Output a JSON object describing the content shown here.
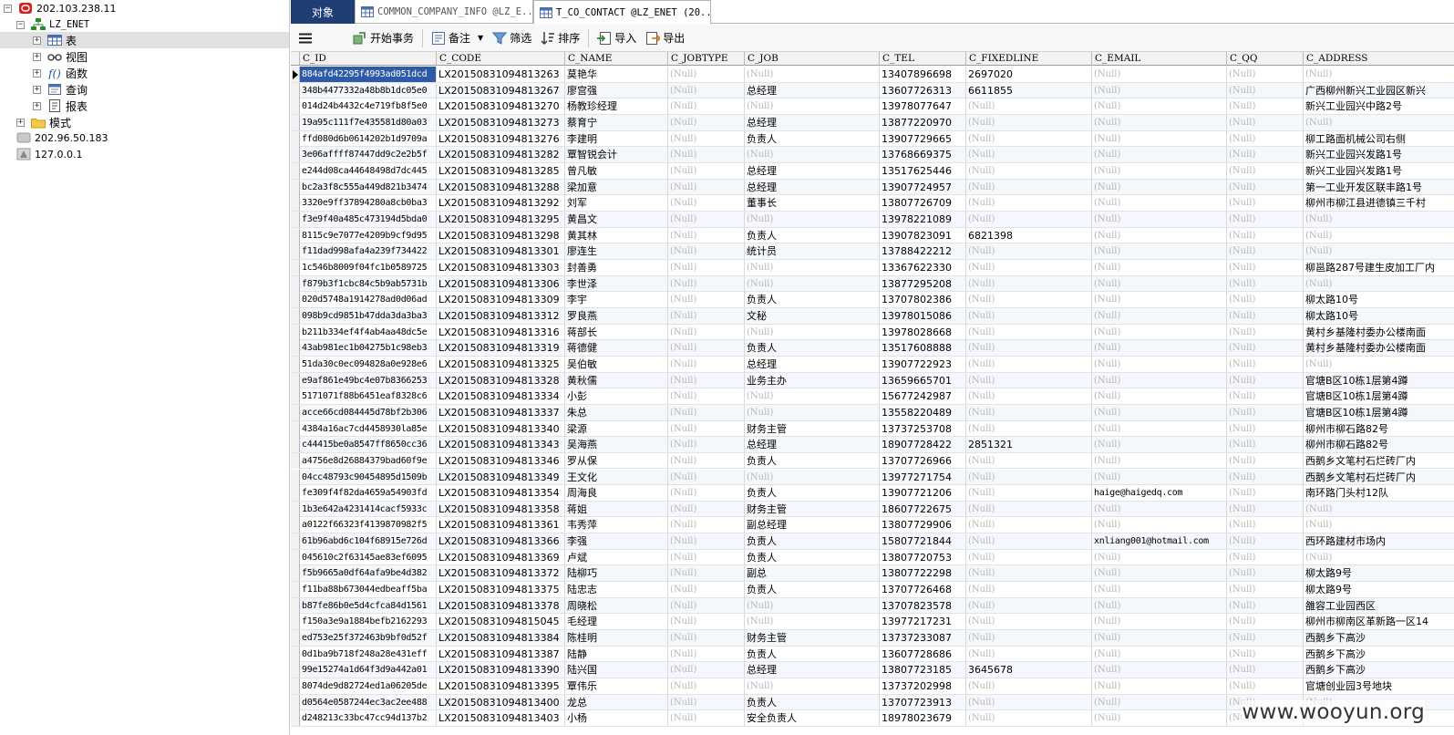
{
  "tree": {
    "nodes": [
      {
        "label": "202.103.238.11",
        "icon": "oracle-connection-icon",
        "toggle": "−",
        "level": 0
      },
      {
        "label": "LZ_ENET",
        "icon": "schema-icon",
        "toggle": "−",
        "level": 1
      },
      {
        "label": "表",
        "icon": "table-icon",
        "toggle": "+",
        "level": 2,
        "selected": true
      },
      {
        "label": "视图",
        "icon": "view-icon",
        "toggle": "+",
        "level": 2
      },
      {
        "label": "函数",
        "icon": "function-icon",
        "toggle": "+",
        "level": 2
      },
      {
        "label": "查询",
        "icon": "query-icon",
        "toggle": "+",
        "level": 2
      },
      {
        "label": "报表",
        "icon": "report-icon",
        "toggle": "+",
        "level": 2
      },
      {
        "label": "模式",
        "icon": "folder-icon",
        "toggle": "+",
        "level": 1
      },
      {
        "label": "202.96.50.183",
        "icon": "connection-icon",
        "toggle": "",
        "level": 0
      },
      {
        "label": "127.0.0.1",
        "icon": "connection-icon",
        "toggle": "",
        "level": 0
      }
    ]
  },
  "tabs": [
    {
      "label": "对象",
      "type": "object"
    },
    {
      "label": "COMMON_COMPANY_INFO @LZ_E...",
      "type": "table"
    },
    {
      "label": "T_CO_CONTACT @LZ_ENET (20...",
      "type": "table",
      "active": true
    }
  ],
  "toolbar": {
    "begin_tx": "开始事务",
    "memo": "备注",
    "filter": "筛选",
    "sort": "排序",
    "import": "导入",
    "export": "导出"
  },
  "grid": {
    "columns": [
      "C_ID",
      "C_CODE",
      "C_NAME",
      "C_JOBTYPE",
      "C_JOB",
      "C_TEL",
      "C_FIXEDLINE",
      "C_EMAIL",
      "C_QQ",
      "C_ADDRESS"
    ],
    "null_text": "(Null)",
    "rows": [
      [
        "884afd42295f4993ad051dcd",
        "LX20150831094813263",
        "莫艳华",
        "(Null)",
        "(Null)",
        "13407896698",
        "2697020",
        "(Null)",
        "(Null)",
        "(Null)"
      ],
      [
        "348b4477332a48b8b1dc05e0",
        "LX20150831094813267",
        "廖宫强",
        "(Null)",
        "总经理",
        "13607726313",
        "6611855",
        "(Null)",
        "(Null)",
        "广西柳州新兴工业园区新兴"
      ],
      [
        "014d24b4432c4e719fb8f5e0",
        "LX20150831094813270",
        "杨教珍经理",
        "(Null)",
        "(Null)",
        "13978077647",
        "(Null)",
        "(Null)",
        "(Null)",
        "新兴工业园兴中路2号"
      ],
      [
        "19a95c111f7e435581d80a03",
        "LX20150831094813273",
        "蔡育宁",
        "(Null)",
        "总经理",
        "13877220970",
        "(Null)",
        "(Null)",
        "(Null)",
        "(Null)"
      ],
      [
        "ffd080d6b0614202b1d9709a",
        "LX20150831094813276",
        "李建明",
        "(Null)",
        "负责人",
        "13907729665",
        "(Null)",
        "(Null)",
        "(Null)",
        "柳工路面机械公司右侧"
      ],
      [
        "3e06affff87447dd9c2e2b5f",
        "LX20150831094813282",
        "覃智锐会计",
        "(Null)",
        "(Null)",
        "13768669375",
        "(Null)",
        "(Null)",
        "(Null)",
        "新兴工业园兴发路1号"
      ],
      [
        "e244d08ca44648498d7dc445",
        "LX20150831094813285",
        "曾凡敏",
        "(Null)",
        "总经理",
        "13517625446",
        "(Null)",
        "(Null)",
        "(Null)",
        "新兴工业园兴发路1号"
      ],
      [
        "bc2a3f8c555a449d821b3474",
        "LX20150831094813288",
        "梁加意",
        "(Null)",
        "总经理",
        "13907724957",
        "(Null)",
        "(Null)",
        "(Null)",
        "第一工业开发区联丰路1号"
      ],
      [
        "3320e9ff37894280a8cb0ba3",
        "LX20150831094813292",
        "刘军",
        "(Null)",
        "董事长",
        "13807726709",
        "(Null)",
        "(Null)",
        "(Null)",
        "柳州市柳江县进德镇三千村"
      ],
      [
        "f3e9f40a485c473194d5bda0",
        "LX20150831094813295",
        "黄昌文",
        "(Null)",
        "(Null)",
        "13978221089",
        "(Null)",
        "(Null)",
        "(Null)",
        "(Null)"
      ],
      [
        "8115c9e7077e4209b9cf9d95",
        "LX20150831094813298",
        "黄其林",
        "(Null)",
        "负责人",
        "13907823091",
        "6821398",
        "(Null)",
        "(Null)",
        "(Null)"
      ],
      [
        "f11dad998afa4a239f734422",
        "LX20150831094813301",
        "廖连生",
        "(Null)",
        "统计员",
        "13788422212",
        "(Null)",
        "(Null)",
        "(Null)",
        "(Null)"
      ],
      [
        "1c546b8009f04fc1b0589725",
        "LX20150831094813303",
        "封善勇",
        "(Null)",
        "(Null)",
        "13367622330",
        "(Null)",
        "(Null)",
        "(Null)",
        "柳邕路287号建生皮加工厂内"
      ],
      [
        "f879b3f1cbc84c5b9ab5731b",
        "LX20150831094813306",
        "李世泽",
        "(Null)",
        "(Null)",
        "13877295208",
        "(Null)",
        "(Null)",
        "(Null)",
        "(Null)"
      ],
      [
        "020d5748a1914278ad0d06ad",
        "LX20150831094813309",
        "李宇",
        "(Null)",
        "负责人",
        "13707802386",
        "(Null)",
        "(Null)",
        "(Null)",
        "柳太路10号"
      ],
      [
        "098b9cd9851b47dda3da3ba3",
        "LX20150831094813312",
        "罗良燕",
        "(Null)",
        "文秘",
        "13978015086",
        "(Null)",
        "(Null)",
        "(Null)",
        "柳太路10号"
      ],
      [
        "b211b334ef4f4ab4aa48dc5e",
        "LX20150831094813316",
        "蒋部长",
        "(Null)",
        "(Null)",
        "13978028668",
        "(Null)",
        "(Null)",
        "(Null)",
        "黄村乡基隆村委办公楼南面"
      ],
      [
        "43ab981ec1b04275b1c98eb3",
        "LX20150831094813319",
        "蒋德健",
        "(Null)",
        "负责人",
        "13517608888",
        "(Null)",
        "(Null)",
        "(Null)",
        "黄村乡基隆村委办公楼南面"
      ],
      [
        "51da30c0ec094828a0e928e6",
        "LX20150831094813325",
        "吴伯敏",
        "(Null)",
        "总经理",
        "13907722923",
        "(Null)",
        "(Null)",
        "(Null)",
        "(Null)"
      ],
      [
        "e9af861e49bc4e07b8366253",
        "LX20150831094813328",
        "黄秋儒",
        "(Null)",
        "业务主办",
        "13659665701",
        "(Null)",
        "(Null)",
        "(Null)",
        "官塘B区10栋1层第4蹲"
      ],
      [
        "5171071f88b6451eaf8328c6",
        "LX20150831094813334",
        "小彭",
        "(Null)",
        "(Null)",
        "15677242987",
        "(Null)",
        "(Null)",
        "(Null)",
        "官塘B区10栋1层第4蹲"
      ],
      [
        "acce66cd084445d78bf2b306",
        "LX20150831094813337",
        "朱总",
        "(Null)",
        "(Null)",
        "13558220489",
        "(Null)",
        "(Null)",
        "(Null)",
        "官塘B区10栋1层第4蹲"
      ],
      [
        "4384a16ac7cd4458930la85e",
        "LX20150831094813340",
        "梁源",
        "(Null)",
        "财务主管",
        "13737253708",
        "(Null)",
        "(Null)",
        "(Null)",
        "柳州市柳石路82号"
      ],
      [
        "c44415be0a8547ff8650cc36",
        "LX20150831094813343",
        "吴海燕",
        "(Null)",
        "总经理",
        "18907728422",
        "2851321",
        "(Null)",
        "(Null)",
        "柳州市柳石路82号"
      ],
      [
        "a4756e8d26884379bad60f9e",
        "LX20150831094813346",
        "罗从保",
        "(Null)",
        "负责人",
        "13707726966",
        "(Null)",
        "(Null)",
        "(Null)",
        "西鹅乡文笔村石烂砖厂内"
      ],
      [
        "04cc48793c90454895d1509b",
        "LX20150831094813349",
        "王文化",
        "(Null)",
        "(Null)",
        "13977271754",
        "(Null)",
        "(Null)",
        "(Null)",
        "西鹅乡文笔村石烂砖厂内"
      ],
      [
        "fe309f4f82da4659a54903fd",
        "LX20150831094813354",
        "周海良",
        "(Null)",
        "负责人",
        "13907721206",
        "(Null)",
        "haige@haigedq.com",
        "(Null)",
        "南环路门头村12队"
      ],
      [
        "1b3e642a4231414cacf5933c",
        "LX20150831094813358",
        "蒋姐",
        "(Null)",
        "财务主管",
        "18607722675",
        "(Null)",
        "(Null)",
        "(Null)",
        "(Null)"
      ],
      [
        "a0122f66323f4139870982f5",
        "LX20150831094813361",
        "韦秀萍",
        "(Null)",
        "副总经理",
        "13807729906",
        "(Null)",
        "(Null)",
        "(Null)",
        "(Null)"
      ],
      [
        "61b96abd6c104f68915e726d",
        "LX20150831094813366",
        "李强",
        "(Null)",
        "负责人",
        "15807721844",
        "(Null)",
        "xnliang001@hotmail.com",
        "(Null)",
        "西环路建材市场内"
      ],
      [
        "045610c2f63145ae83ef6095",
        "LX20150831094813369",
        "卢斌",
        "(Null)",
        "负责人",
        "13807720753",
        "(Null)",
        "(Null)",
        "(Null)",
        "(Null)"
      ],
      [
        "f5b9665a0df64afa9be4d382",
        "LX20150831094813372",
        "陆柳巧",
        "(Null)",
        "副总",
        "13807722298",
        "(Null)",
        "(Null)",
        "(Null)",
        "柳太路9号"
      ],
      [
        "f11ba88b673044edbeaff5ba",
        "LX20150831094813375",
        "陆忠志",
        "(Null)",
        "负责人",
        "13707726468",
        "(Null)",
        "(Null)",
        "(Null)",
        "柳太路9号"
      ],
      [
        "b87fe86b0e5d4cfca84d1561",
        "LX20150831094813378",
        "周晓松",
        "(Null)",
        "(Null)",
        "13707823578",
        "(Null)",
        "(Null)",
        "(Null)",
        "雒容工业园西区"
      ],
      [
        "f150a3e9a1884befb2162293",
        "LX20150831094815045",
        "毛经理",
        "(Null)",
        "(Null)",
        "13977217231",
        "(Null)",
        "(Null)",
        "(Null)",
        "柳州市柳南区革新路一区14"
      ],
      [
        "ed753e25f372463b9bf0d52f",
        "LX20150831094813384",
        "陈桂明",
        "(Null)",
        "财务主管",
        "13737233087",
        "(Null)",
        "(Null)",
        "(Null)",
        "西鹅乡下高沙"
      ],
      [
        "0d1ba9b718f248a28e431eff",
        "LX20150831094813387",
        "陆静",
        "(Null)",
        "负责人",
        "13607728686",
        "(Null)",
        "(Null)",
        "(Null)",
        "西鹅乡下高沙"
      ],
      [
        "99e15274a1d64f3d9a442a01",
        "LX20150831094813390",
        "陆兴国",
        "(Null)",
        "总经理",
        "13807723185",
        "3645678",
        "(Null)",
        "(Null)",
        "西鹅乡下高沙"
      ],
      [
        "8074de9d82724ed1a06205de",
        "LX20150831094813395",
        "覃伟乐",
        "(Null)",
        "(Null)",
        "13737202998",
        "(Null)",
        "(Null)",
        "(Null)",
        "官塘创业园3号地块"
      ],
      [
        "d0564e0587244ec3ac2ee488",
        "LX20150831094813400",
        "龙总",
        "(Null)",
        "负责人",
        "13707723913",
        "(Null)",
        "(Null)",
        "(Null)",
        "(Null)"
      ],
      [
        "d248213c33bc47cc94d137b2",
        "LX20150831094813403",
        "小杨",
        "(Null)",
        "安全负责人",
        "18978023679",
        "(Null)",
        "(Null)",
        "(Null)",
        "(Null)"
      ]
    ]
  },
  "watermark": "www.wooyun.org",
  "colors": {
    "object_tab": "#1f3e74",
    "selection": "#2e5ba8",
    "null_text": "#b7b7b7"
  }
}
